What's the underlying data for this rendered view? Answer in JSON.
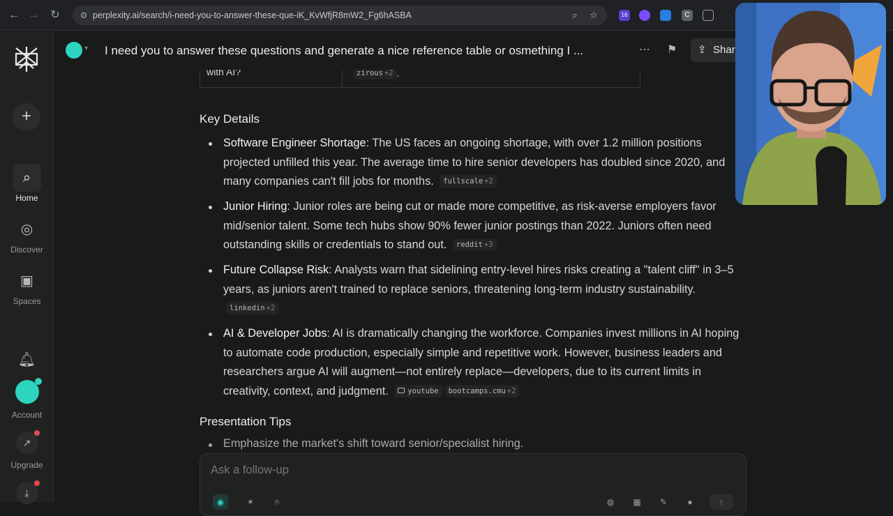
{
  "browser": {
    "url": "perplexity.ai/search/i-need-you-to-answer-these-que-iK_KvWfjR8mW2_Fg6hASBA",
    "extension_badge": "16"
  },
  "sidebar": {
    "items": [
      {
        "label": "Home",
        "icon": "search-icon"
      },
      {
        "label": "Discover",
        "icon": "globe-icon"
      },
      {
        "label": "Spaces",
        "icon": "spaces-icon"
      },
      {
        "label": "Account",
        "icon": "avatar"
      },
      {
        "label": "Upgrade",
        "icon": "upgrade-icon"
      }
    ]
  },
  "thread": {
    "title": "I need you to answer these questions and generate a nice reference table or osmething I ...",
    "share_label": "Shar"
  },
  "table_stub": {
    "cell1": "with AI?",
    "cell2_source": "zirous",
    "cell2_more": "+2",
    "cell2_tail": "."
  },
  "key_details": {
    "heading": "Key Details",
    "items": [
      {
        "title": "Software Engineer Shortage",
        "text": ": The US faces an ongoing shortage, with over 1.2 million positions projected unfilled this year. The average time to hire senior developers has doubled since 2020, and many companies can't fill jobs for months.",
        "citations": [
          {
            "source": "fullscale",
            "more": "+2"
          }
        ]
      },
      {
        "title": "Junior Hiring",
        "text": ": Junior roles are being cut or made more competitive, as risk-averse employers favor mid/senior talent. Some tech hubs show 90% fewer junior postings than 2022. Juniors often need outstanding skills or credentials to stand out.",
        "citations": [
          {
            "source": "reddit",
            "more": "+3"
          }
        ]
      },
      {
        "title": "Future Collapse Risk",
        "text": ": Analysts warn that sidelining entry-level hires risks creating a \"talent cliff\" in 3–5 years, as juniors aren't trained to replace seniors, threatening long-term industry sustainability.",
        "citations": [
          {
            "source": "linkedin",
            "more": "+2"
          }
        ]
      },
      {
        "title": "AI & Developer Jobs",
        "text": ": AI is dramatically changing the workforce. Companies invest millions in AI hoping to automate code production, especially simple and repetitive work. However, business leaders and researchers argue AI will augment—not entirely replace—developers, due to its current limits in creativity, context, and judgment.",
        "citations": [
          {
            "source": "youtube",
            "more": ""
          },
          {
            "source": "bootcamps.cmu",
            "more": "+2"
          }
        ]
      }
    ]
  },
  "presentation_tips": {
    "heading": "Presentation Tips",
    "first_item": "Emphasize the market's shift toward senior/specialist hiring."
  },
  "followup": {
    "placeholder": "Ask a follow-up"
  },
  "colors": {
    "background": "#191a1a",
    "sidebar": "#202222",
    "accent": "#2dd4c0",
    "notification": "#e5484d"
  }
}
